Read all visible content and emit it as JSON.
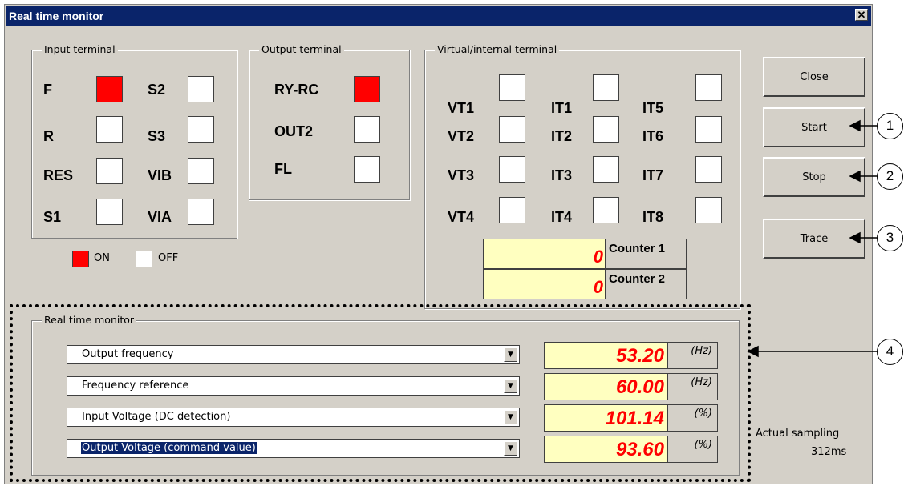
{
  "window": {
    "title": "Real time monitor",
    "close_glyph": "✕"
  },
  "input_terminal": {
    "label": "Input terminal",
    "items": [
      {
        "name": "F",
        "state": "on"
      },
      {
        "name": "R",
        "state": "off"
      },
      {
        "name": "RES",
        "state": "off"
      },
      {
        "name": "S1",
        "state": "off"
      },
      {
        "name": "S2",
        "state": "off"
      },
      {
        "name": "S3",
        "state": "off"
      },
      {
        "name": "VIB",
        "state": "off"
      },
      {
        "name": "VIA",
        "state": "off"
      }
    ]
  },
  "output_terminal": {
    "label": "Output terminal",
    "items": [
      {
        "name": "RY-RC",
        "state": "on"
      },
      {
        "name": "OUT2",
        "state": "off"
      },
      {
        "name": "FL",
        "state": "off"
      }
    ]
  },
  "virtual_terminal": {
    "label": "Virtual/internal terminal",
    "items": [
      {
        "name": "VT1",
        "state": "off"
      },
      {
        "name": "IT1",
        "state": "off"
      },
      {
        "name": "IT5",
        "state": "off"
      },
      {
        "name": "VT2",
        "state": "off"
      },
      {
        "name": "IT2",
        "state": "off"
      },
      {
        "name": "IT6",
        "state": "off"
      },
      {
        "name": "VT3",
        "state": "off"
      },
      {
        "name": "IT3",
        "state": "off"
      },
      {
        "name": "IT7",
        "state": "off"
      },
      {
        "name": "VT4",
        "state": "off"
      },
      {
        "name": "IT4",
        "state": "off"
      },
      {
        "name": "IT8",
        "state": "off"
      }
    ],
    "counters": [
      {
        "value": "0",
        "label": "Counter 1"
      },
      {
        "value": "0",
        "label": "Counter 2"
      }
    ]
  },
  "legend": {
    "on_label": "ON",
    "off_label": "OFF",
    "on_color": "#ff0000",
    "off_color": "#ffffff"
  },
  "buttons": {
    "close": "Close",
    "start": "Start",
    "stop": "Stop",
    "trace": "Trace"
  },
  "monitor": {
    "label": "Real time monitor",
    "rows": [
      {
        "item": "Output frequency",
        "value": "53.20",
        "unit": "(Hz)",
        "selected": false
      },
      {
        "item": "Frequency reference",
        "value": "60.00",
        "unit": "(Hz)",
        "selected": false
      },
      {
        "item": "Input Voltage (DC detection)",
        "value": "101.14",
        "unit": "(%)",
        "selected": false
      },
      {
        "item": "Output Voltage (command value)",
        "value": "93.60",
        "unit": "(%)",
        "selected": true
      }
    ]
  },
  "sampling": {
    "label": "Actual sampling",
    "value": "312ms"
  },
  "callouts": [
    "1",
    "2",
    "3",
    "4"
  ],
  "colors": {
    "title_bar": "#0a246a",
    "value_bg": "#ffffc0",
    "value_text": "#ff0000",
    "face": "#d4d0c8"
  }
}
